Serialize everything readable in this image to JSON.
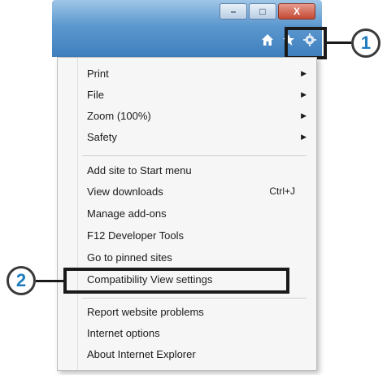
{
  "window": {
    "minimize_label": "–",
    "maximize_label": "□",
    "close_label": "X"
  },
  "toolbar": {
    "icons": [
      "home-icon",
      "favorites-star-icon",
      "gear-icon"
    ]
  },
  "menu": {
    "items": [
      {
        "label": "Print",
        "submenu": true
      },
      {
        "label": "File",
        "submenu": true
      },
      {
        "label": "Zoom (100%)",
        "submenu": true
      },
      {
        "label": "Safety",
        "submenu": true
      },
      {
        "label": "Add site to Start menu"
      },
      {
        "label": "View downloads",
        "shortcut": "Ctrl+J"
      },
      {
        "label": "Manage add-ons"
      },
      {
        "label": "F12 Developer Tools"
      },
      {
        "label": "Go to pinned sites"
      },
      {
        "label": "Compatibility View settings"
      },
      {
        "label": "Report website problems"
      },
      {
        "label": "Internet options"
      },
      {
        "label": "About Internet Explorer"
      }
    ],
    "submenu_arrow": "▶"
  },
  "callouts": {
    "one": "1",
    "two": "2"
  },
  "colors": {
    "callout_number": "#1f7dbf",
    "titlebar": "#4f8cc8",
    "close_button": "#c44a35"
  }
}
